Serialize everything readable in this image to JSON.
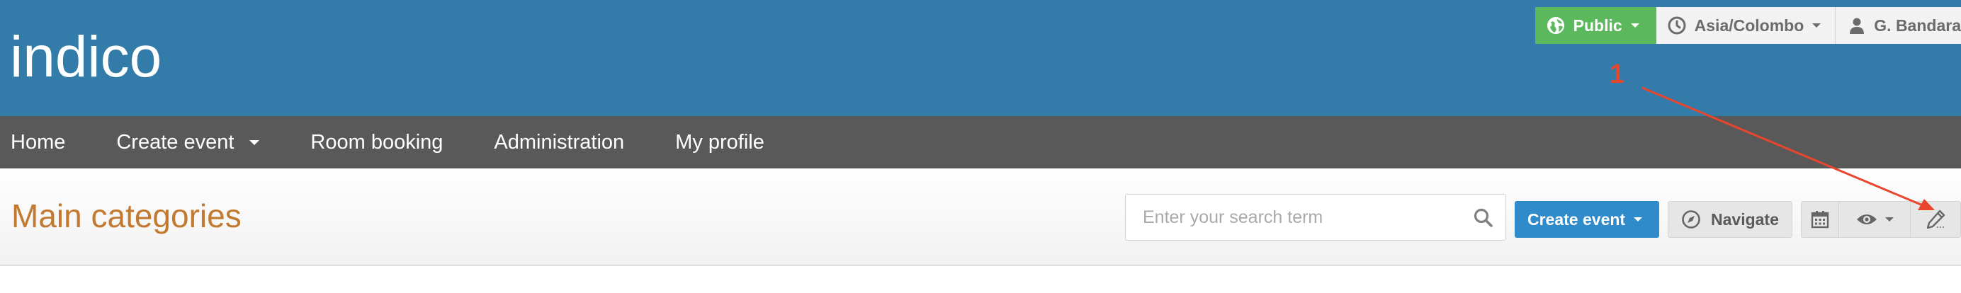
{
  "brand": {
    "logo_text": "indico"
  },
  "user_bar": {
    "visibility": "Public",
    "timezone": "Asia/Colombo",
    "user_name": "G. Bandara"
  },
  "nav": {
    "items": [
      {
        "label": "Home"
      },
      {
        "label": "Create event"
      },
      {
        "label": "Room booking"
      },
      {
        "label": "Administration"
      },
      {
        "label": "My profile"
      }
    ]
  },
  "title_bar": {
    "title": "Main categories",
    "search_placeholder": "Enter your search term",
    "create_event_label": "Create event",
    "navigate_label": "Navigate"
  },
  "annotation": {
    "label": "1"
  },
  "colors": {
    "header": "#337ba8",
    "nav": "#595959",
    "public_badge": "#5cb85c",
    "title": "#c27a30",
    "primary_button": "#2f8bc9",
    "annotation": "#e8462d"
  },
  "icons": [
    "globe-icon",
    "clock-icon",
    "user-icon",
    "search-icon",
    "compass-icon",
    "calendar-icon",
    "eye-icon",
    "pencil-icon"
  ]
}
